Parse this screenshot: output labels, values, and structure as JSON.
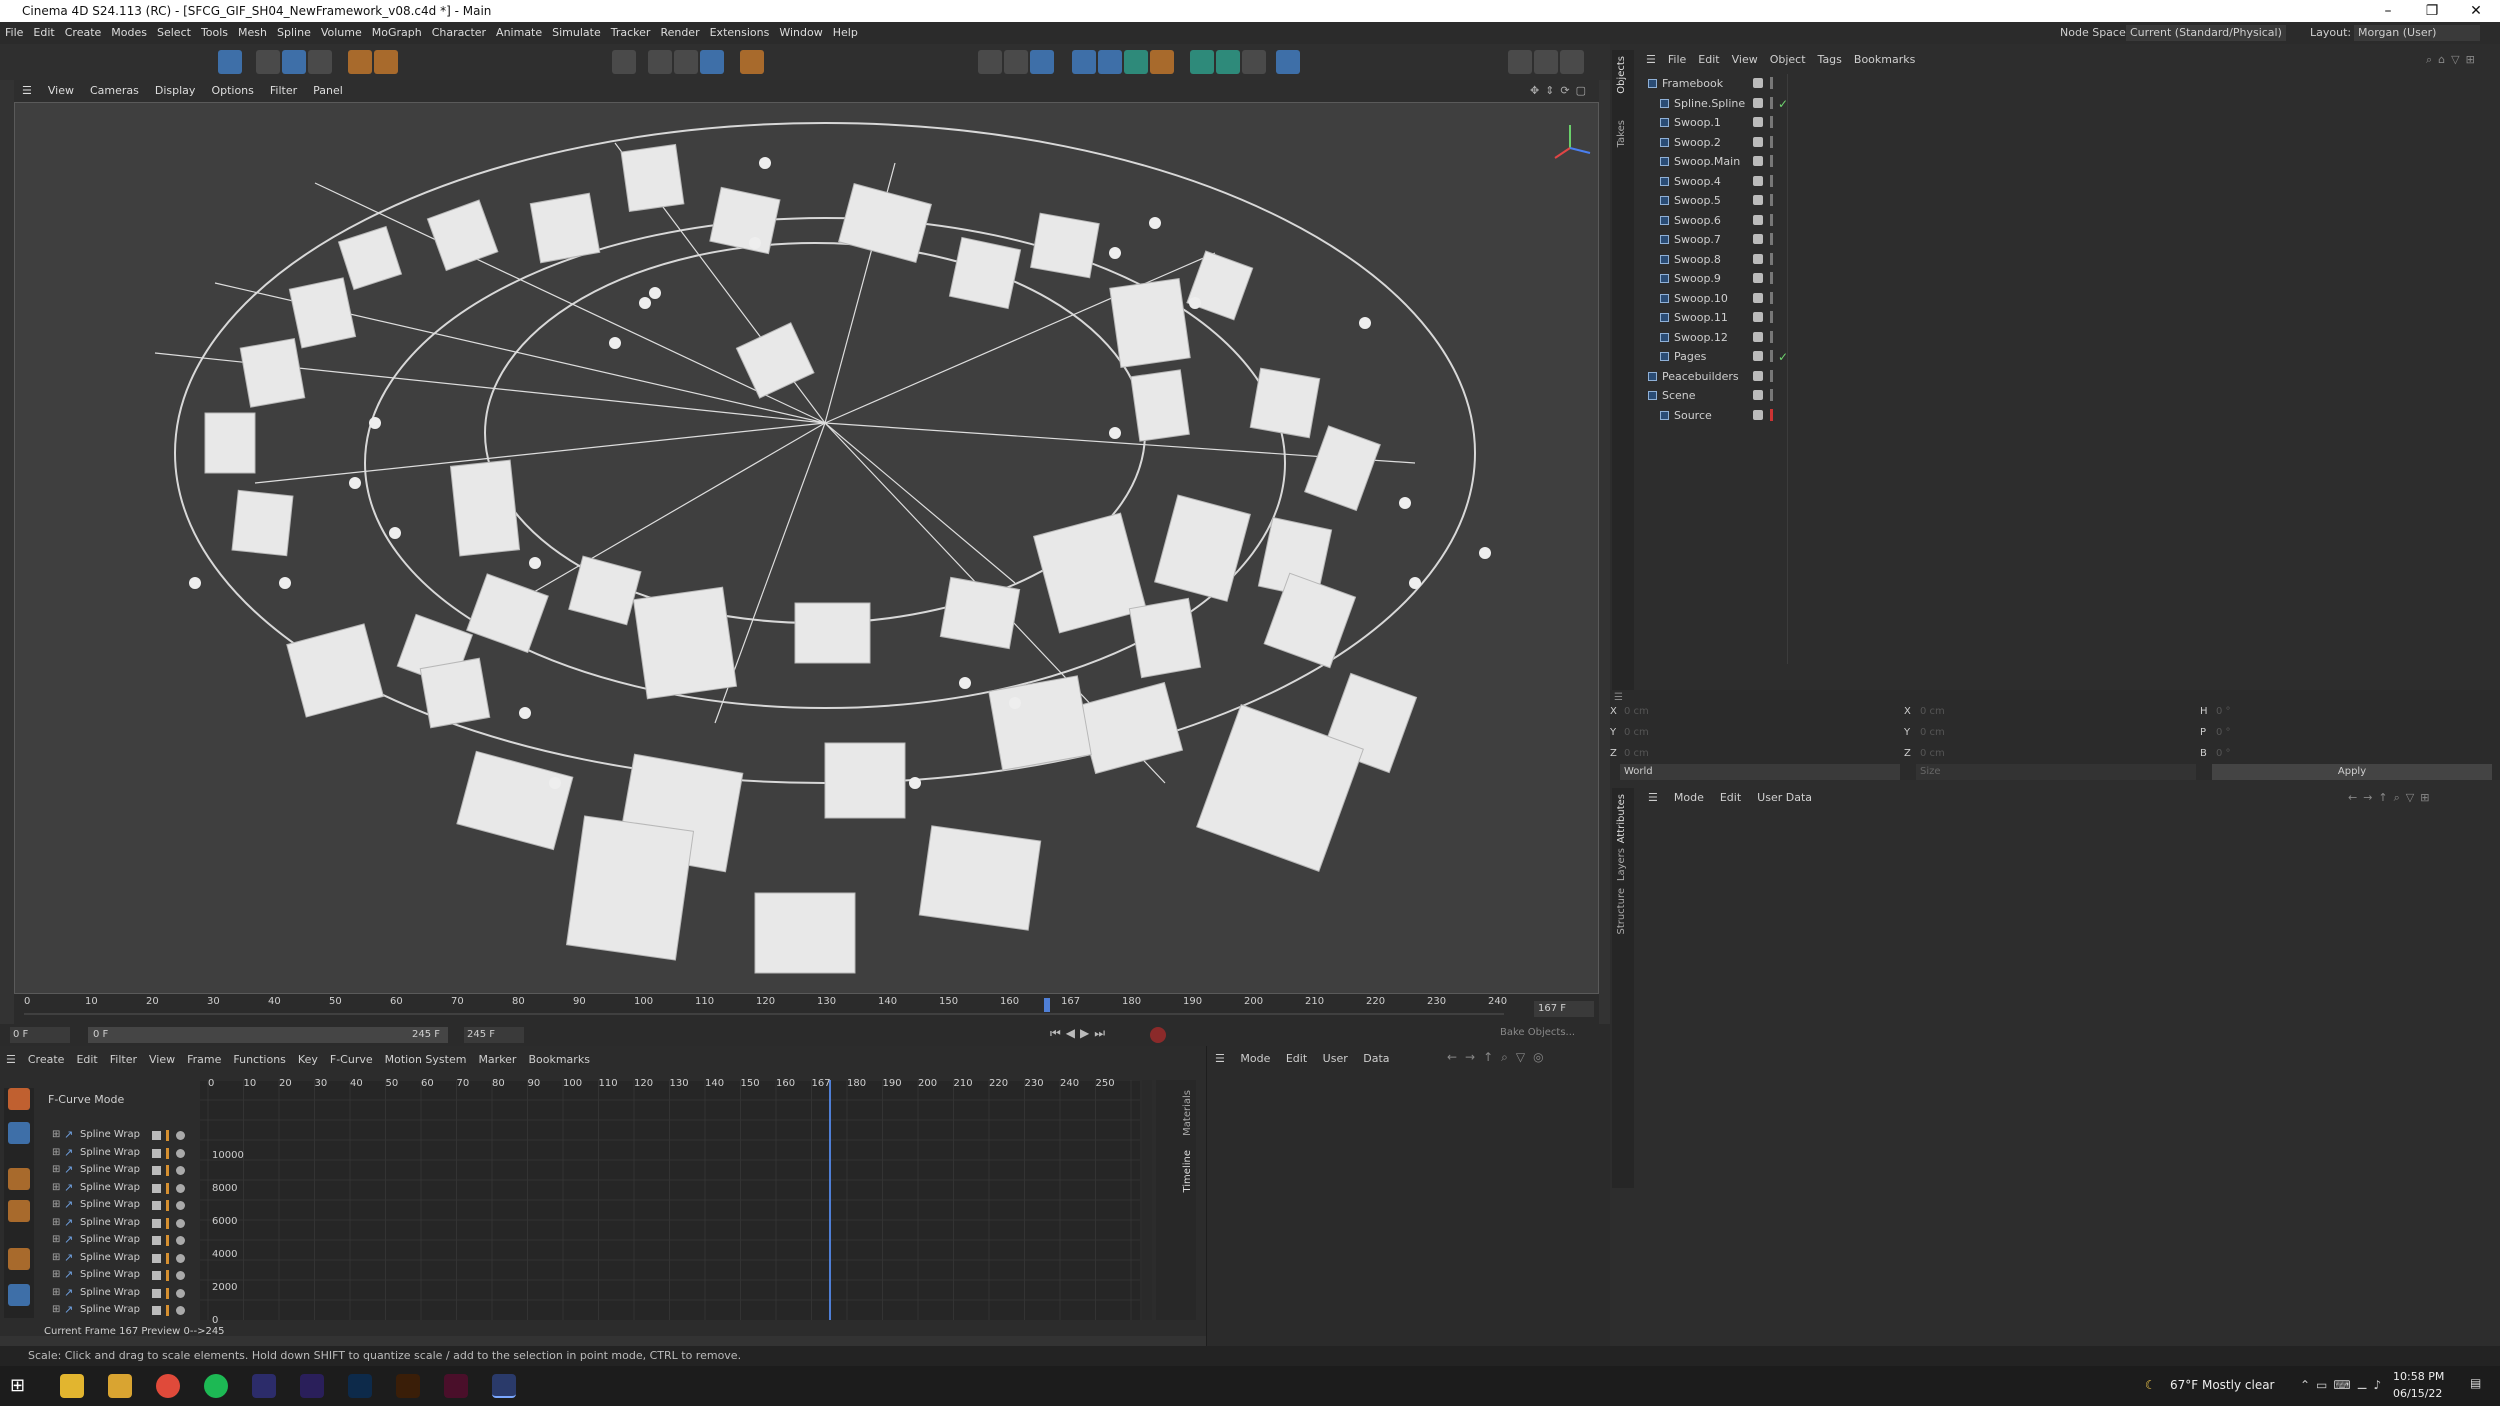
{
  "window": {
    "title": "Cinema 4D S24.113 (RC) - [SFCG_GIF_SH04_NewFramework_v08.c4d *] - Main"
  },
  "menubar": {
    "items": [
      "File",
      "Edit",
      "Create",
      "Modes",
      "Select",
      "Tools",
      "Mesh",
      "Spline",
      "Volume",
      "MoGraph",
      "Character",
      "Animate",
      "Simulate",
      "Tracker",
      "Render",
      "Extensions",
      "Window",
      "Help"
    ],
    "node_space_label": "Node Space:",
    "node_space_value": "Current (Standard/Physical)",
    "layout_label": "Layout:",
    "layout_value": "Morgan (User)"
  },
  "viewport": {
    "menu": [
      "View",
      "Cameras",
      "Display",
      "Options",
      "Filter",
      "Panel"
    ]
  },
  "timeline": {
    "ruler_ticks": [
      "0",
      "10",
      "20",
      "30",
      "40",
      "50",
      "60",
      "70",
      "80",
      "90",
      "100",
      "110",
      "120",
      "130",
      "140",
      "150",
      "160",
      "167",
      "180",
      "190",
      "200",
      "210",
      "220",
      "230",
      "240"
    ],
    "current_frame": "167 F",
    "start": "0 F",
    "start2": "0 F",
    "end": "245 F",
    "end2": "245 F",
    "bake_button": "Bake Objects..."
  },
  "fcurve": {
    "menu": [
      "Create",
      "Edit",
      "Filter",
      "View",
      "Frame",
      "Functions",
      "Key",
      "F-Curve",
      "Motion System",
      "Marker",
      "Bookmarks"
    ],
    "mode_label": "F-Curve Mode",
    "tracks": [
      "Spline Wrap",
      "Spline Wrap",
      "Spline Wrap",
      "Spline Wrap",
      "Spline Wrap",
      "Spline Wrap",
      "Spline Wrap",
      "Spline Wrap",
      "Spline Wrap",
      "Spline Wrap",
      "Spline Wrap"
    ],
    "yticks": [
      "10000",
      "8000",
      "6000",
      "4000",
      "2000",
      "0"
    ],
    "xticks": [
      "0",
      "10",
      "20",
      "30",
      "40",
      "50",
      "60",
      "70",
      "80",
      "90",
      "100",
      "110",
      "120",
      "130",
      "140",
      "150",
      "160",
      "167",
      "180",
      "190",
      "200",
      "210",
      "220",
      "230",
      "240",
      "250"
    ],
    "footer_current": "Current Frame",
    "footer_frame": "167",
    "footer_preview": "Preview",
    "footer_range": "0-->245",
    "side_menu": [
      "Mode",
      "Edit",
      "User Data"
    ]
  },
  "objects": {
    "menu": [
      "File",
      "Edit",
      "View",
      "Object",
      "Tags",
      "Bookmarks"
    ],
    "tree": [
      "Framebook",
      "Spline.Spline",
      "Swoop.1",
      "Swoop.2",
      "Swoop.Main",
      "Swoop.4",
      "Swoop.5",
      "Swoop.6",
      "Swoop.7",
      "Swoop.8",
      "Swoop.9",
      "Swoop.10",
      "Swoop.11",
      "Swoop.12",
      "Pages",
      "Peacebuilders",
      "Scene",
      "Source"
    ]
  },
  "coords": {
    "x": "X",
    "y": "Y",
    "z": "Z",
    "h": "H",
    "p": "P",
    "b": "B",
    "val": "0 cm",
    "ang": "0 °",
    "world": "World",
    "size": "Size",
    "apply": "Apply"
  },
  "attributes": {
    "menu": [
      "Mode",
      "Edit",
      "User Data"
    ],
    "tabs": [
      "Attributes",
      "Layers",
      "Structure"
    ],
    "obj_tabs": [
      "Objects",
      "Takes"
    ]
  },
  "status": {
    "text": "Scale: Click and drag to scale elements. Hold down SHIFT to quantize scale / add to the selection in point mode, CTRL to remove."
  },
  "taskbar": {
    "weather": "67°F  Mostly clear",
    "time": "10:58 PM",
    "date": "06/15/22"
  },
  "colors": {
    "accent": "#3e6fa8",
    "bg": "#333333"
  }
}
